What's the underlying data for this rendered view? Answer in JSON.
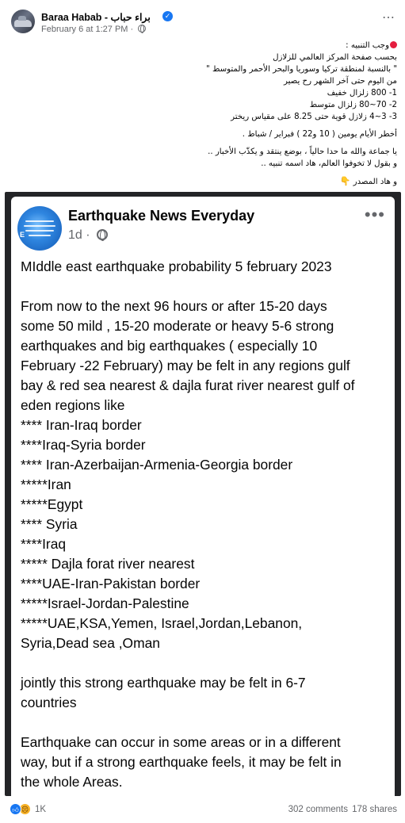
{
  "post": {
    "author": "Baraa Habab - براء حباب",
    "date": "February 6 at 1:27 PM",
    "meta_separator": "·",
    "more_icon": "⋯",
    "arabic_lines": [
      "وجب التنبيه :",
      "بحسب صفحة المركز العالمي للزلازل",
      "\" بالنسبة لمنطقة تركيا وسوريا والبحر الأحمر والمتوسط \"",
      "من اليوم حتى آخر الشهر رح يصير",
      "1-  800 زلزال خفيف",
      "2- 70~80 زلزال متوسط",
      "3- 3~4 زلازل قوية حتى 8.25 على مقياس ريختر"
    ],
    "arabic_line_days": "أخطر الأيام يومين ( 10 و22 ) فبراير / شباط .",
    "arabic_lines_end": [
      "يا جماعة والله ما حدا حالياً ، بوضع ينتقد و يكذّب الأخبار ..",
      "و بقول لا تخوفوا العالم، هاد اسمه تنبيه .."
    ],
    "arabic_source": "و هاد المصدر",
    "source_hand_icon": "👇"
  },
  "shared_card": {
    "page_name": "Earthquake News Everyday",
    "age": "1d",
    "separator": "·",
    "more_icon": "•••",
    "avatar_label": "E",
    "body_lines": [
      "MIddle east   earthquake probability 5 february 2023",
      "",
      "From now to the next 96  hours or after 15-20 days",
      "some 50 mild ,  15-20 moderate or heavy 5-6 strong",
      "earthquakes and big earthquakes ( especially 10",
      "February -22 February) may be felt in any regions  gulf",
      "bay & red sea  nearest & dajla furat river nearest gulf of",
      "eden regions  like",
      "**** Iran-Iraq border",
      "****Iraq-Syria border",
      "**** Iran-Azerbaijan-Armenia-Georgia border",
      "*****Iran",
      "*****Egypt",
      "**** Syria",
      "****Iraq",
      "***** Dajla forat river nearest",
      "****UAE-Iran-Pakistan border",
      "*****Israel-Jordan-Palestine",
      "*****UAE,KSA,Yemen, Israel,Jordan,Lebanon,",
      "Syria,Dead sea ,Oman",
      "",
      "jointly this strong earthquake may be felt in 6-7",
      "countries",
      "",
      "Earthquake can occur in some areas or in a different",
      "way, but if a strong earthquake feels, it may be felt in",
      "the whole Areas."
    ]
  },
  "footer": {
    "reaction_count": "1K",
    "comments": "302 comments",
    "shares": "178 shares",
    "like_icon": "👍",
    "sad_icon": "😢"
  }
}
